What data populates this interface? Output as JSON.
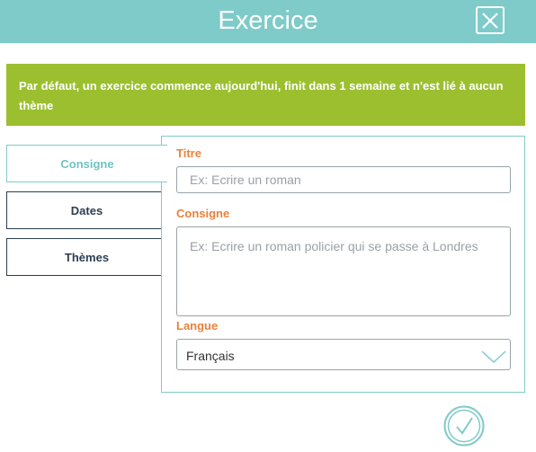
{
  "header": {
    "title": "Exercice",
    "close_icon": "close-icon",
    "color": "#7ecbc9"
  },
  "banner": {
    "text": "Par défaut, un exercice commence aujourd'hui, finit dans 1 semaine et n'est lié à aucun thème",
    "color": "#9cbf2f"
  },
  "tabs": [
    {
      "label": "Consigne",
      "active": true
    },
    {
      "label": "Dates",
      "active": false
    },
    {
      "label": "Thèmes",
      "active": false
    }
  ],
  "form": {
    "titre": {
      "label": "Titre",
      "placeholder": "Ex: Ecrire un roman",
      "value": ""
    },
    "consigne": {
      "label": "Consigne",
      "placeholder": "Ex: Ecrire un roman policier qui se passe à Londres",
      "value": ""
    },
    "langue": {
      "label": "Langue",
      "value": "Français",
      "icon": "chevron-down-icon"
    },
    "label_color": "#e8823c"
  },
  "confirm": {
    "icon": "check-circle-icon"
  }
}
